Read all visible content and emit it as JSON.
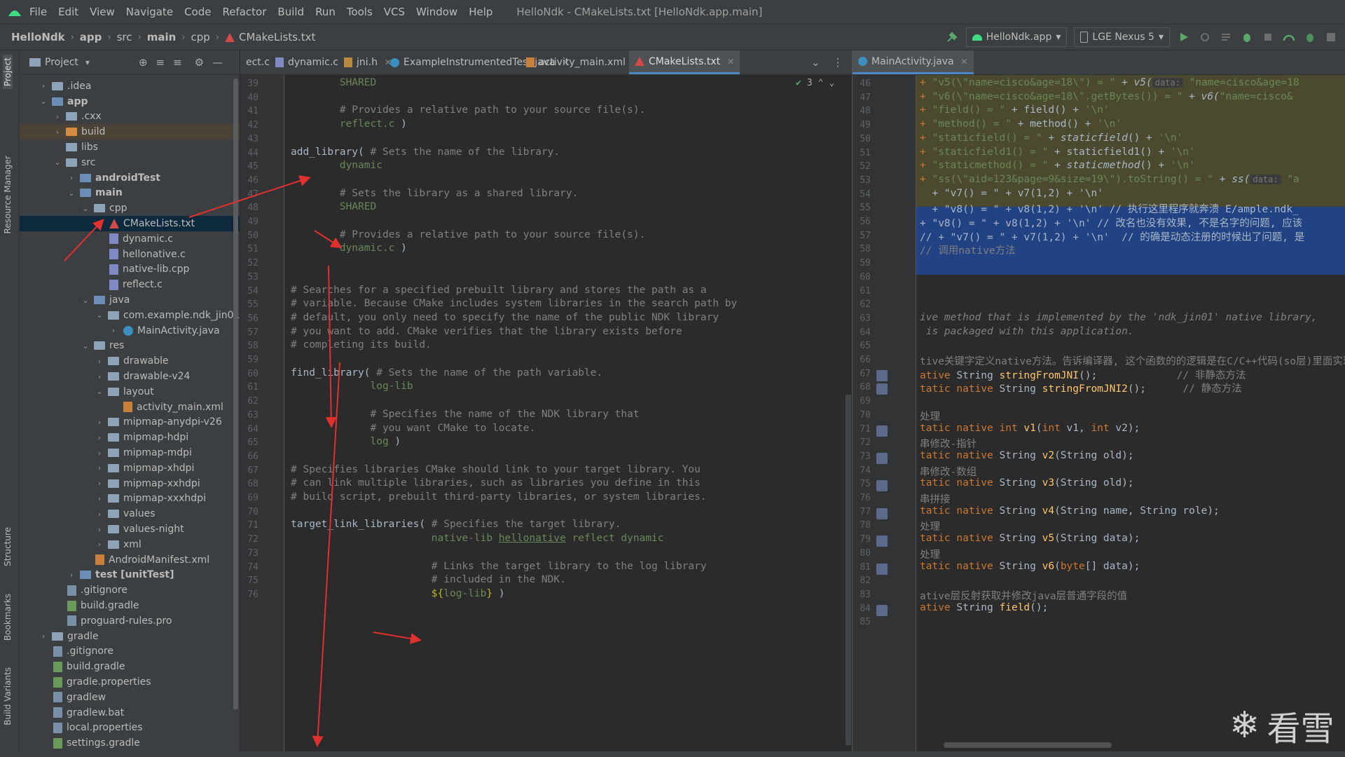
{
  "menu": [
    "File",
    "Edit",
    "View",
    "Navigate",
    "Code",
    "Refactor",
    "Build",
    "Run",
    "Tools",
    "VCS",
    "Window",
    "Help"
  ],
  "window_title": "HelloNdk - CMakeLists.txt [HelloNdk.app.main]",
  "breadcrumbs": [
    "HelloNdk",
    "app",
    "src",
    "main",
    "cpp",
    "CMakeLists.txt"
  ],
  "run_config": "HelloNdk.app",
  "device": "LGE Nexus 5",
  "project_panel": {
    "title": "Project"
  },
  "tool_windows": [
    "Project",
    "Resource Manager",
    "Structure",
    "Bookmarks",
    "Build Variants"
  ],
  "tree": [
    {
      "d": 1,
      "chev": ">",
      "icon": "folder",
      "label": ".idea"
    },
    {
      "d": 1,
      "chev": "v",
      "icon": "folder-module",
      "label": "app",
      "bold": true
    },
    {
      "d": 2,
      "chev": ">",
      "icon": "folder",
      "label": ".cxx"
    },
    {
      "d": 2,
      "chev": ">",
      "icon": "folder-orange",
      "label": "build",
      "hl": true
    },
    {
      "d": 2,
      "chev": "",
      "icon": "folder",
      "label": "libs"
    },
    {
      "d": 2,
      "chev": "v",
      "icon": "folder",
      "label": "src"
    },
    {
      "d": 3,
      "chev": ">",
      "icon": "folder-blue",
      "label": "androidTest",
      "bold": true
    },
    {
      "d": 3,
      "chev": "v",
      "icon": "folder-blue",
      "label": "main",
      "bold": true
    },
    {
      "d": 4,
      "chev": "v",
      "icon": "folder",
      "label": "cpp"
    },
    {
      "d": 5,
      "chev": "",
      "icon": "cmake",
      "label": "CMakeLists.txt",
      "sel": true
    },
    {
      "d": 5,
      "chev": "",
      "icon": "c",
      "label": "dynamic.c"
    },
    {
      "d": 5,
      "chev": "",
      "icon": "c",
      "label": "hellonative.c"
    },
    {
      "d": 5,
      "chev": "",
      "icon": "c",
      "label": "native-lib.cpp"
    },
    {
      "d": 5,
      "chev": "",
      "icon": "c",
      "label": "reflect.c"
    },
    {
      "d": 4,
      "chev": "v",
      "icon": "folder-blue",
      "label": "java"
    },
    {
      "d": 5,
      "chev": "v",
      "icon": "folder",
      "label": "com.example.ndk_jin01"
    },
    {
      "d": 6,
      "chev": ">",
      "icon": "java",
      "label": "MainActivity.java"
    },
    {
      "d": 4,
      "chev": "v",
      "icon": "folder",
      "label": "res"
    },
    {
      "d": 5,
      "chev": ">",
      "icon": "folder",
      "label": "drawable"
    },
    {
      "d": 5,
      "chev": ">",
      "icon": "folder",
      "label": "drawable-v24"
    },
    {
      "d": 5,
      "chev": "v",
      "icon": "folder",
      "label": "layout"
    },
    {
      "d": 6,
      "chev": "",
      "icon": "xml",
      "label": "activity_main.xml"
    },
    {
      "d": 5,
      "chev": ">",
      "icon": "folder",
      "label": "mipmap-anydpi-v26"
    },
    {
      "d": 5,
      "chev": ">",
      "icon": "folder",
      "label": "mipmap-hdpi"
    },
    {
      "d": 5,
      "chev": ">",
      "icon": "folder",
      "label": "mipmap-mdpi"
    },
    {
      "d": 5,
      "chev": ">",
      "icon": "folder",
      "label": "mipmap-xhdpi"
    },
    {
      "d": 5,
      "chev": ">",
      "icon": "folder",
      "label": "mipmap-xxhdpi"
    },
    {
      "d": 5,
      "chev": ">",
      "icon": "folder",
      "label": "mipmap-xxxhdpi"
    },
    {
      "d": 5,
      "chev": ">",
      "icon": "folder",
      "label": "values"
    },
    {
      "d": 5,
      "chev": ">",
      "icon": "folder",
      "label": "values-night"
    },
    {
      "d": 5,
      "chev": ">",
      "icon": "folder",
      "label": "xml"
    },
    {
      "d": 4,
      "chev": "",
      "icon": "xml",
      "label": "AndroidManifest.xml"
    },
    {
      "d": 3,
      "chev": ">",
      "icon": "folder-green",
      "label": "test [unitTest]",
      "bold": true
    },
    {
      "d": 2,
      "chev": "",
      "icon": "file",
      "label": ".gitignore"
    },
    {
      "d": 2,
      "chev": "",
      "icon": "gradle",
      "label": "build.gradle"
    },
    {
      "d": 2,
      "chev": "",
      "icon": "file",
      "label": "proguard-rules.pro"
    },
    {
      "d": 1,
      "chev": ">",
      "icon": "folder",
      "label": "gradle"
    },
    {
      "d": 1,
      "chev": "",
      "icon": "file",
      "label": ".gitignore"
    },
    {
      "d": 1,
      "chev": "",
      "icon": "gradle",
      "label": "build.gradle"
    },
    {
      "d": 1,
      "chev": "",
      "icon": "gradle",
      "label": "gradle.properties"
    },
    {
      "d": 1,
      "chev": "",
      "icon": "file",
      "label": "gradlew"
    },
    {
      "d": 1,
      "chev": "",
      "icon": "file",
      "label": "gradlew.bat"
    },
    {
      "d": 1,
      "chev": "",
      "icon": "file",
      "label": "local.properties"
    },
    {
      "d": 1,
      "chev": "",
      "icon": "gradle",
      "label": "settings.gradle"
    }
  ],
  "tabs": [
    {
      "label": "ect.c",
      "icon": "c"
    },
    {
      "label": "dynamic.c",
      "icon": "c"
    },
    {
      "label": "jni.h",
      "icon": "h"
    },
    {
      "label": "ExampleInstrumentedTest.java",
      "icon": "java"
    },
    {
      "label": "activity_main.xml",
      "icon": "xml"
    },
    {
      "label": "CMakeLists.txt",
      "icon": "cmake",
      "active": true
    }
  ],
  "right_tab": {
    "label": "MainActivity.java"
  },
  "inspection_count": "3",
  "editor1": {
    "first_line": 39,
    "lines": [
      [
        [
          "        SHARED",
          "vv"
        ]
      ],
      [],
      [
        [
          "        # Provides a relative path to your source file(s).",
          "cm"
        ]
      ],
      [
        [
          "        reflect.c ",
          "vv"
        ],
        [
          ")",
          "kw2"
        ]
      ],
      [],
      [
        [
          "add_library( ",
          "kw2"
        ],
        [
          "# Sets the name of the library.",
          "cm"
        ]
      ],
      [
        [
          "        dynamic",
          "vv"
        ]
      ],
      [],
      [
        [
          "        # Sets the library as a shared library.",
          "cm"
        ]
      ],
      [
        [
          "        SHARED",
          "vv"
        ]
      ],
      [],
      [
        [
          "        # Provides a relative path to your source file(s).",
          "cm"
        ]
      ],
      [
        [
          "        dynamic.c ",
          "vv"
        ],
        [
          ")",
          "kw2"
        ]
      ],
      [],
      [],
      [
        [
          "# Searches for a specified prebuilt library and stores the path as a",
          "cm"
        ]
      ],
      [
        [
          "# variable. Because CMake includes system libraries in the search path by",
          "cm"
        ]
      ],
      [
        [
          "# default, you only need to specify the name of the public NDK library",
          "cm"
        ]
      ],
      [
        [
          "# you want to add. CMake verifies that the library exists before",
          "cm"
        ]
      ],
      [
        [
          "# completing its build.",
          "cm"
        ]
      ],
      [],
      [
        [
          "find_library( ",
          "kw2"
        ],
        [
          "# Sets the name of the path variable.",
          "cm"
        ]
      ],
      [
        [
          "             log-lib",
          "vv"
        ]
      ],
      [],
      [
        [
          "             # Specifies the name of the NDK library that",
          "cm"
        ]
      ],
      [
        [
          "             # you want CMake to locate.",
          "cm"
        ]
      ],
      [
        [
          "             log ",
          "vv"
        ],
        [
          ")",
          "kw2"
        ]
      ],
      [],
      [
        [
          "# Specifies libraries CMake should link to your target library. You",
          "cm"
        ]
      ],
      [
        [
          "# can link multiple libraries, such as libraries you define in this",
          "cm"
        ]
      ],
      [
        [
          "# build script, prebuilt third-party libraries, or system libraries.",
          "cm"
        ]
      ],
      [],
      [
        [
          "target_link_libraries( ",
          "kw2"
        ],
        [
          "# Specifies the target library.",
          "cm"
        ]
      ],
      [
        [
          "                       native-lib ",
          "vv"
        ],
        [
          "hellonative",
          "vv und"
        ],
        [
          " reflect dynamic",
          "vv"
        ]
      ],
      [],
      [
        [
          "                       # Links the target library to the log library",
          "cm"
        ]
      ],
      [
        [
          "                       # included in the NDK.",
          "cm"
        ]
      ],
      [
        [
          "                       ",
          "vv"
        ],
        [
          "${",
          "gr"
        ],
        [
          "log-lib",
          "vv"
        ],
        [
          "}",
          "gr"
        ],
        [
          " )",
          "kw2"
        ]
      ]
    ]
  },
  "editor2": {
    "first_line": 46,
    "lines": [
      [
        [
          "+ ",
          "jkw"
        ],
        [
          "\"v5(\\\"name=cisco&age=18\\\") = \"",
          "str"
        ],
        [
          " + ",
          "kw2"
        ],
        [
          "v5(",
          "it"
        ],
        [
          "data:",
          "hint"
        ],
        [
          " \"name=cisco&age=18",
          "str"
        ]
      ],
      [
        [
          "+ ",
          "jkw"
        ],
        [
          "\"v6(\\\"name=cisco&age=18\\\".getBytes()) = \"",
          "str"
        ],
        [
          " + ",
          "kw2"
        ],
        [
          "v6(",
          "it"
        ],
        [
          "\"name=cisco&",
          "str"
        ]
      ],
      [
        [
          "+ ",
          "jkw"
        ],
        [
          "\"field() = \"",
          "str"
        ],
        [
          " + field() + ",
          "kw2"
        ],
        [
          "'\\n'",
          "str"
        ]
      ],
      [
        [
          "+ ",
          "jkw"
        ],
        [
          "\"method() = \"",
          "str"
        ],
        [
          " + method() + ",
          "kw2"
        ],
        [
          "'\\n'",
          "str"
        ]
      ],
      [
        [
          "+ ",
          "jkw"
        ],
        [
          "\"staticfield() = \"",
          "str"
        ],
        [
          " + ",
          "kw2"
        ],
        [
          "staticfield",
          "it"
        ],
        [
          "() + ",
          "kw2"
        ],
        [
          "'\\n'",
          "str"
        ]
      ],
      [
        [
          "+ ",
          "jkw"
        ],
        [
          "\"staticfield1() = \"",
          "str"
        ],
        [
          " + staticfield1() + ",
          "kw2"
        ],
        [
          "'\\n'",
          "str"
        ]
      ],
      [
        [
          "+ ",
          "jkw"
        ],
        [
          "\"staticmethod() = \"",
          "str"
        ],
        [
          " + ",
          "kw2"
        ],
        [
          "staticmethod",
          "it"
        ],
        [
          "() + ",
          "kw2"
        ],
        [
          "'\\n'",
          "str"
        ]
      ],
      [
        [
          "+ ",
          "jkw"
        ],
        [
          "\"ss(\\\"aid=123&page=9&size=19\\\").toString() = \"",
          "str"
        ],
        [
          " + ",
          "kw2"
        ],
        [
          "ss(",
          "it"
        ],
        [
          "data:",
          "hint"
        ],
        [
          " \"a",
          "str"
        ]
      ],
      [
        [
          "  + ",
          "kw2"
        ],
        [
          "\"v7() = \"",
          "kw2"
        ],
        [
          " + v7(1,2) + ",
          "kw2"
        ],
        [
          "'\\n'",
          "kw2"
        ]
      ],
      [
        [
          "  + ",
          "kw2"
        ],
        [
          "\"v8() = \"",
          "kw2"
        ],
        [
          " + v8(1,2) + ",
          "kw2"
        ],
        [
          "'\\n'",
          "kw2"
        ],
        [
          " // 执行这里程序就奔溃 E/ample.ndk_",
          "kw2"
        ]
      ],
      [
        [
          "+ ",
          "kw2"
        ],
        [
          "\"v8() = \"",
          "kw2"
        ],
        [
          " + v8(1,2) + ",
          "kw2"
        ],
        [
          "'\\n'",
          "kw2"
        ],
        [
          " // 改名也没有效果, 不是名字的问题, 应该",
          "kw2"
        ]
      ],
      [
        [
          "// + ",
          "kw2"
        ],
        [
          "\"v7() = \"",
          "kw2"
        ],
        [
          " + v7(1,2) + ",
          "kw2"
        ],
        [
          "'\\n'",
          "kw2"
        ],
        [
          "  // 的确是动态注册的时候出了问题, 是",
          "kw2"
        ]
      ],
      [
        [
          "// 调用native方法",
          "cmt"
        ]
      ],
      [],
      [],
      [],
      [],
      [
        [
          "ive method that is implemented by the 'ndk_jin01' native library,",
          "cmt it"
        ]
      ],
      [
        [
          " is packaged with this application.",
          "cmt it"
        ]
      ],
      [],
      [
        [
          "tive关键字定义native方法。告诉编译器, 这个函数的的逻辑是在C/C++代码(so层)里面实现",
          "cmt"
        ]
      ],
      [
        [
          "ative ",
          "jkw"
        ],
        [
          "String ",
          "kw2"
        ],
        [
          "stringFromJNI",
          "fn"
        ],
        [
          "();",
          "kw2"
        ],
        [
          "             // 非静态方法",
          "cmt"
        ]
      ],
      [
        [
          "tatic native ",
          "jkw"
        ],
        [
          "String ",
          "kw2"
        ],
        [
          "stringFromJNI2",
          "fn"
        ],
        [
          "();",
          "kw2"
        ],
        [
          "      // 静态方法",
          "cmt"
        ]
      ],
      [],
      [
        [
          "处理",
          "cmt"
        ]
      ],
      [
        [
          "tatic native int ",
          "jkw"
        ],
        [
          "v1",
          "fn"
        ],
        [
          "(",
          "kw2"
        ],
        [
          "int ",
          "jkw"
        ],
        [
          "v1, ",
          "kw2"
        ],
        [
          "int ",
          "jkw"
        ],
        [
          "v2);",
          "kw2"
        ]
      ],
      [
        [
          "串修改-指针",
          "cmt"
        ]
      ],
      [
        [
          "tatic native ",
          "jkw"
        ],
        [
          "String ",
          "kw2"
        ],
        [
          "v2",
          "fn"
        ],
        [
          "(String old);",
          "kw2"
        ]
      ],
      [
        [
          "串修改-数组",
          "cmt"
        ]
      ],
      [
        [
          "tatic native ",
          "jkw"
        ],
        [
          "String ",
          "kw2"
        ],
        [
          "v3",
          "fn"
        ],
        [
          "(String old);",
          "kw2"
        ]
      ],
      [
        [
          "串拼接",
          "cmt"
        ]
      ],
      [
        [
          "tatic native ",
          "jkw"
        ],
        [
          "String ",
          "kw2"
        ],
        [
          "v4",
          "fn"
        ],
        [
          "(String name, String role);",
          "kw2"
        ]
      ],
      [
        [
          "处理",
          "cmt"
        ]
      ],
      [
        [
          "tatic native ",
          "jkw"
        ],
        [
          "String ",
          "kw2"
        ],
        [
          "v5",
          "fn"
        ],
        [
          "(String data);",
          "kw2"
        ]
      ],
      [
        [
          "处理",
          "cmt"
        ]
      ],
      [
        [
          "tatic native ",
          "jkw"
        ],
        [
          "String ",
          "kw2"
        ],
        [
          "v6",
          "fn"
        ],
        [
          "(",
          "kw2"
        ],
        [
          "byte",
          "jkw"
        ],
        [
          "[] data);",
          "kw2"
        ]
      ],
      [],
      [
        [
          "ative层反射获取并修改java层普通字段的值",
          "cmt"
        ]
      ],
      [
        [
          "ative ",
          "jkw"
        ],
        [
          "String ",
          "kw2"
        ],
        [
          "field",
          "fn"
        ],
        [
          "();",
          "kw2"
        ]
      ],
      []
    ]
  },
  "watermark": "看雪",
  "colors": {
    "bg": "#2b2b2b",
    "panel": "#3c3f41",
    "selection": "#0d293e",
    "accent": "#4a88c7",
    "arrow": "#e0312f",
    "diff_added": "#4b4a2e",
    "diff_selected": "#214283"
  }
}
